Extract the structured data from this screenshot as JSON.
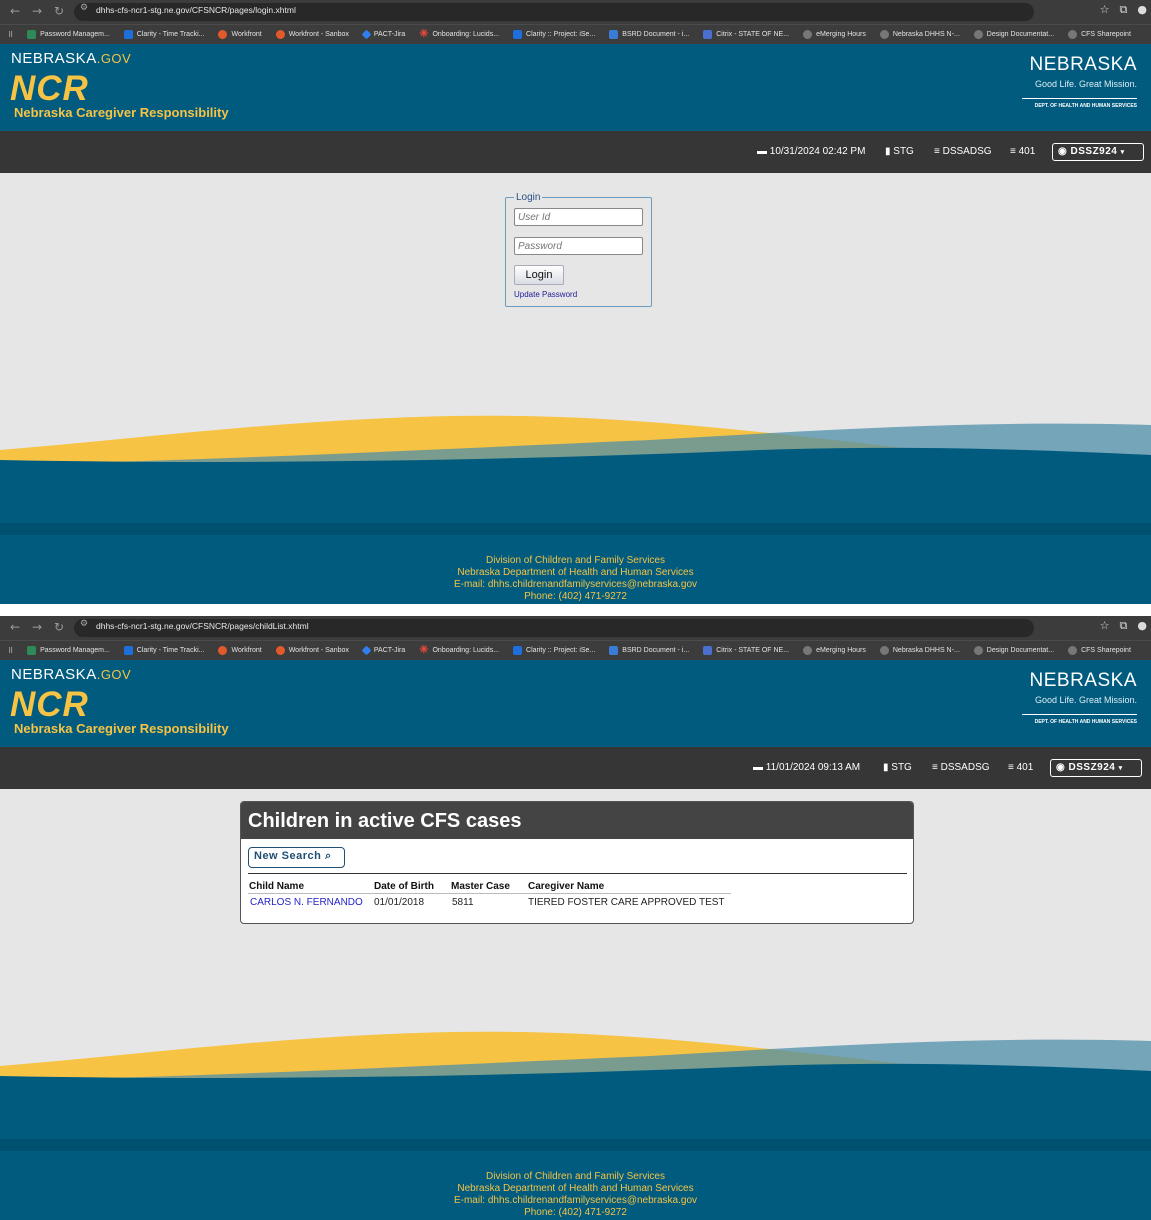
{
  "browser": {
    "bookmarks": [
      "Password Managem...",
      "Clarity - Time Tracki...",
      "Workfront",
      "Workfront - Sanbox",
      "PACT-Jira",
      "Onboarding: Lucids...",
      "Clarity :: Project: iSe...",
      "BSRD Document - i...",
      "Citrix - STATE OF NE...",
      "eMerging Hours",
      "Nebraska DHHS N-...",
      "Design Documentat...",
      "CFS Sharepoint"
    ]
  },
  "header": {
    "nebraska_gov": "NEBRASKA",
    "gov_suffix": ".GOV",
    "app_abbrev": "NCR",
    "app_name": "Nebraska Caregiver Responsibility",
    "logo_title": "NEBRASKA",
    "logo_tagline": "Good Life. Great Mission.",
    "logo_dept": "DEPT. OF HEALTH AND HUMAN SERVICES"
  },
  "footer": {
    "line1": "Division of Children and Family Services",
    "line2": "Nebraska Department of Health and Human Services",
    "line3": "E-mail: dhhs.childrenandfamilyservices@nebraska.gov",
    "line4": "Phone: (402) 471-9272"
  },
  "screen1": {
    "url": "dhhs-cfs-ncr1-stg.ne.gov/CFSNCR/pages/login.xhtml",
    "datetime": "10/31/2024 02:42 PM",
    "env": "STG",
    "db": "DSSADSG",
    "server": "401",
    "user": "DSSZ924",
    "login": {
      "legend": "Login",
      "userid_placeholder": "User Id",
      "password_placeholder": "Password",
      "button": "Login",
      "update_password": "Update Password"
    }
  },
  "screen2": {
    "url": "dhhs-cfs-ncr1-stg.ne.gov/CFSNCR/pages/childList.xhtml",
    "datetime": "11/01/2024 09:13 AM",
    "env": "STG",
    "db": "DSSADSG",
    "server": "401",
    "user": "DSSZ924",
    "panel_title": "Children in active CFS cases",
    "new_search": "New Search",
    "columns": [
      "Child Name",
      "Date of Birth",
      "Master Case",
      "Caregiver Name"
    ],
    "rows": [
      [
        "CARLOS N. FERNANDO",
        "01/01/2018",
        "5811",
        "TIERED FOSTER CARE APPROVED TEST"
      ]
    ]
  },
  "colors": {
    "brand_blue": "#005b7f",
    "gold": "#f6c344",
    "info_bar": "#363636"
  }
}
